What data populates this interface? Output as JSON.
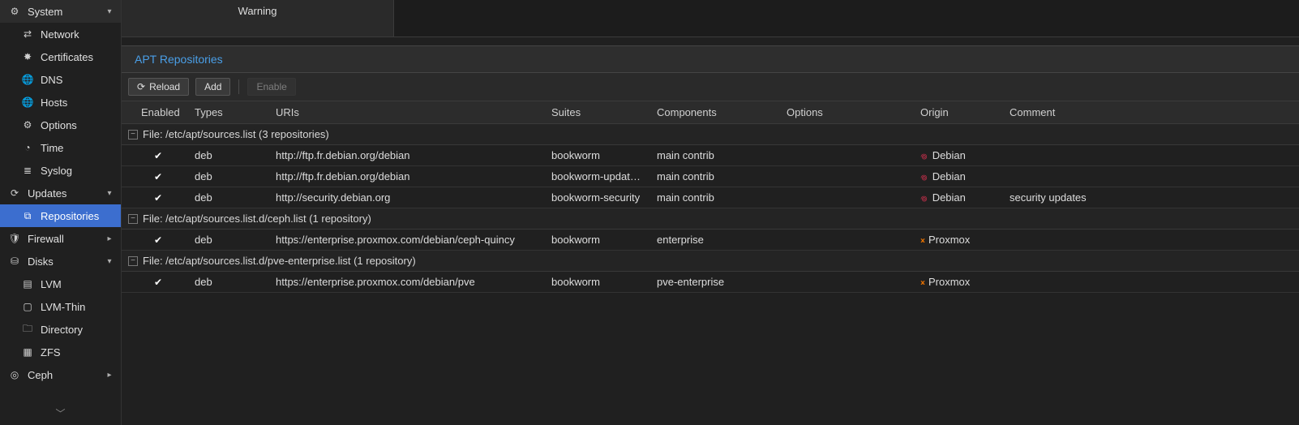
{
  "sidebar": {
    "items": [
      {
        "label": "System",
        "icon": "⚙",
        "chevron": "▾",
        "level": 0
      },
      {
        "label": "Network",
        "icon": "⇄",
        "chevron": "",
        "level": 1
      },
      {
        "label": "Certificates",
        "icon": "✸",
        "chevron": "",
        "level": 1
      },
      {
        "label": "DNS",
        "icon": "🌐",
        "chevron": "",
        "level": 1
      },
      {
        "label": "Hosts",
        "icon": "🌐",
        "chevron": "",
        "level": 1
      },
      {
        "label": "Options",
        "icon": "⚙",
        "chevron": "",
        "level": 1
      },
      {
        "label": "Time",
        "icon": "◔",
        "chevron": "",
        "level": 1
      },
      {
        "label": "Syslog",
        "icon": "≣",
        "chevron": "",
        "level": 1
      },
      {
        "label": "Updates",
        "icon": "⟳",
        "chevron": "▾",
        "level": 0
      },
      {
        "label": "Repositories",
        "icon": "⧉",
        "chevron": "",
        "level": 1,
        "selected": true
      },
      {
        "label": "Firewall",
        "icon": "🛡",
        "chevron": "▸",
        "level": 0
      },
      {
        "label": "Disks",
        "icon": "⛁",
        "chevron": "▾",
        "level": 0
      },
      {
        "label": "LVM",
        "icon": "▤",
        "chevron": "",
        "level": 1
      },
      {
        "label": "LVM-Thin",
        "icon": "▢",
        "chevron": "",
        "level": 1
      },
      {
        "label": "Directory",
        "icon": "🗀",
        "chevron": "",
        "level": 1
      },
      {
        "label": "ZFS",
        "icon": "▦",
        "chevron": "",
        "level": 1
      },
      {
        "label": "Ceph",
        "icon": "◎",
        "chevron": "▸",
        "level": 0
      }
    ]
  },
  "top": {
    "warning": "Warning"
  },
  "panel": {
    "title": "APT Repositories"
  },
  "toolbar": {
    "reload_icon": "⟳",
    "reload": "Reload",
    "add": "Add",
    "enable": "Enable"
  },
  "table": {
    "headers": {
      "enabled": "Enabled",
      "types": "Types",
      "uris": "URIs",
      "suites": "Suites",
      "components": "Components",
      "options": "Options",
      "origin": "Origin",
      "comment": "Comment"
    },
    "groups": [
      {
        "label": "File: /etc/apt/sources.list (3 repositories)",
        "rows": [
          {
            "enabled": "✔",
            "types": "deb",
            "uris": "http://ftp.fr.debian.org/debian",
            "suites": "bookworm",
            "components": "main contrib",
            "options": "",
            "origin": "Debian",
            "origin_ico": "debian",
            "comment": ""
          },
          {
            "enabled": "✔",
            "types": "deb",
            "uris": "http://ftp.fr.debian.org/debian",
            "suites": "bookworm-updat…",
            "components": "main contrib",
            "options": "",
            "origin": "Debian",
            "origin_ico": "debian",
            "comment": ""
          },
          {
            "enabled": "✔",
            "types": "deb",
            "uris": "http://security.debian.org",
            "suites": "bookworm-security",
            "components": "main contrib",
            "options": "",
            "origin": "Debian",
            "origin_ico": "debian",
            "comment": "security updates"
          }
        ]
      },
      {
        "label": "File: /etc/apt/sources.list.d/ceph.list (1 repository)",
        "rows": [
          {
            "enabled": "✔",
            "types": "deb",
            "uris": "https://enterprise.proxmox.com/debian/ceph-quincy",
            "suites": "bookworm",
            "components": "enterprise",
            "options": "",
            "origin": "Proxmox",
            "origin_ico": "proxmox",
            "comment": ""
          }
        ]
      },
      {
        "label": "File: /etc/apt/sources.list.d/pve-enterprise.list (1 repository)",
        "rows": [
          {
            "enabled": "✔",
            "types": "deb",
            "uris": "https://enterprise.proxmox.com/debian/pve",
            "suites": "bookworm",
            "components": "pve-enterprise",
            "options": "",
            "origin": "Proxmox",
            "origin_ico": "proxmox",
            "comment": ""
          }
        ]
      }
    ]
  }
}
